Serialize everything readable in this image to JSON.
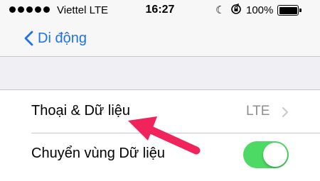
{
  "status_bar": {
    "carrier": "Viettel  LTE",
    "time": "16:27",
    "battery_percent": "100%",
    "signal_bars": 5
  },
  "nav": {
    "back_label": "Di động",
    "back_icon": "chevron-left-icon"
  },
  "settings": {
    "rows": [
      {
        "label": "Thoại & Dữ liệu",
        "value": "LTE",
        "accessory": "chevron-right-icon"
      },
      {
        "label": "Chuyển vùng Dữ liệu",
        "toggle_on": true
      }
    ]
  },
  "colors": {
    "accent": "#1d72e8",
    "toggle_on": "#4cd964",
    "annotation_arrow": "#f0245a"
  }
}
